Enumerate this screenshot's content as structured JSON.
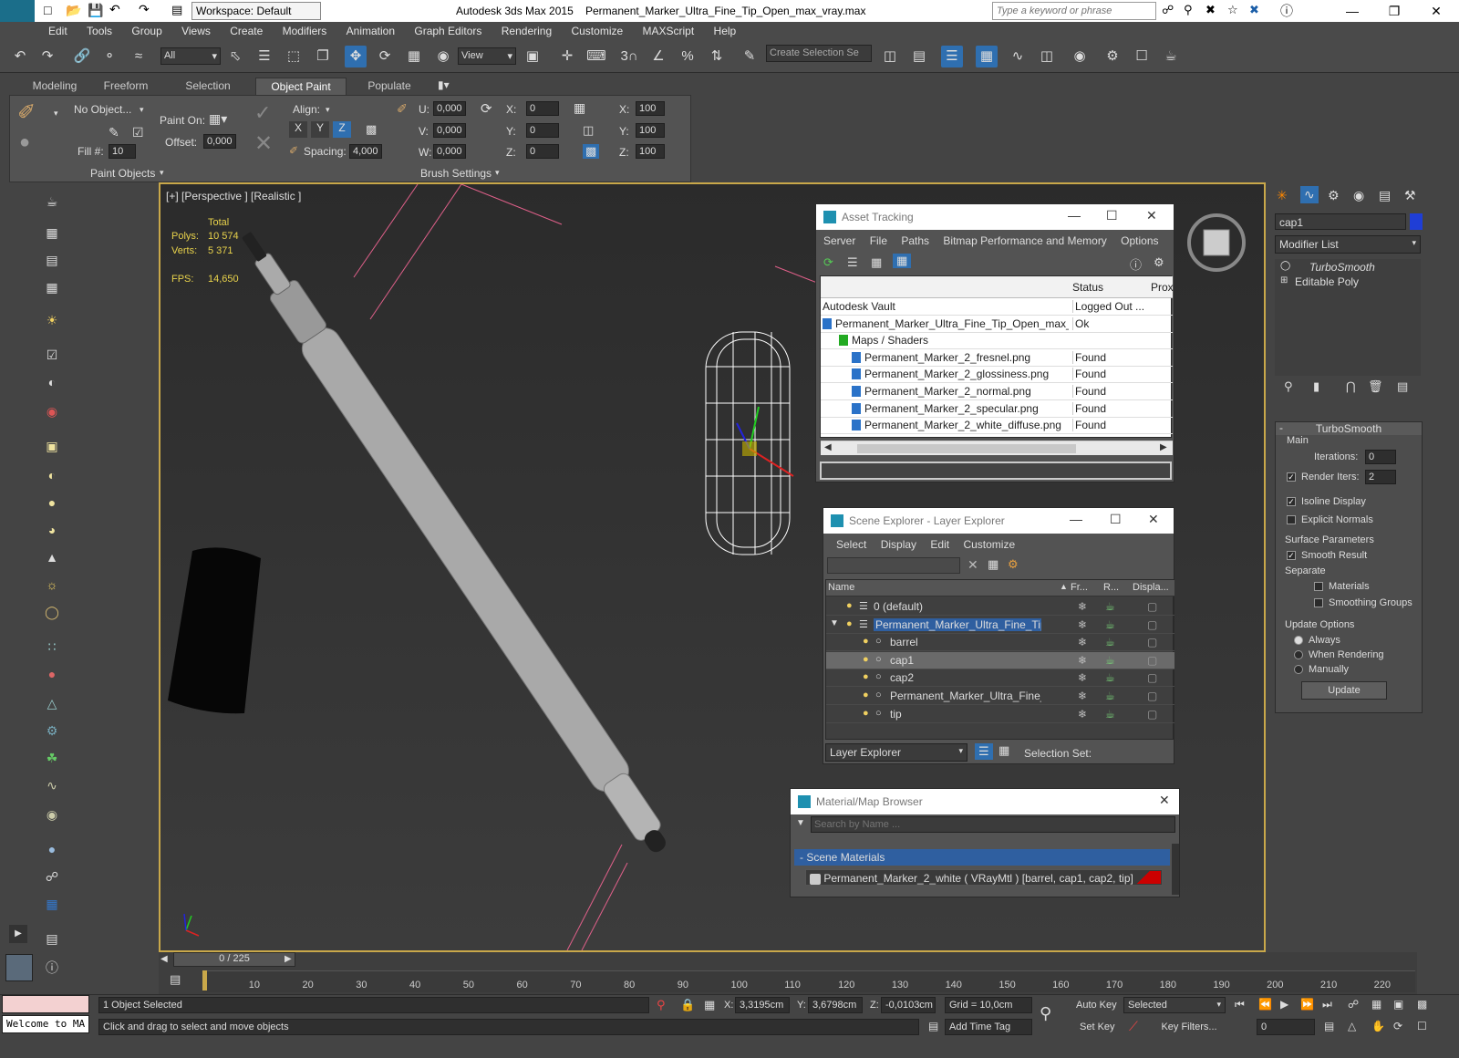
{
  "titlebar": {
    "workspace": "Workspace: Default",
    "app_title": "Autodesk 3ds Max  2015",
    "file_name": "Permanent_Marker_Ultra_Fine_Tip_Open_max_vray.max",
    "search_placeholder": "Type a keyword or phrase"
  },
  "menu": [
    "Edit",
    "Tools",
    "Group",
    "Views",
    "Create",
    "Modifiers",
    "Animation",
    "Graph Editors",
    "Rendering",
    "Customize",
    "MAXScript",
    "Help"
  ],
  "toolbar": {
    "selection_filter": "All",
    "ref_coord": "View",
    "selection_set_placeholder": "Create Selection Se"
  },
  "ribbon": {
    "tabs": [
      "Modeling",
      "Freeform",
      "Selection",
      "Object Paint",
      "Populate"
    ],
    "active_tab": "Object Paint",
    "no_object": "No Object...",
    "paint_on": "Paint On:",
    "offset_label": "Offset:",
    "offset_val": "0,000",
    "fill_label": "Fill #:",
    "fill_val": "10",
    "align_label": "Align:",
    "spacing_label": "Spacing:",
    "spacing_val": "4,000",
    "u_label": "U:",
    "u_val": "0,000",
    "v_label": "V:",
    "v_val": "0,000",
    "w_label": "W:",
    "w_val": "0,000",
    "x_label": "X:",
    "x_val": "0",
    "y_label": "Y:",
    "y_val": "0",
    "z_label": "Z:",
    "z_val": "0",
    "sx_label": "X:",
    "sx_val": "100",
    "sy_label": "Y:",
    "sy_val": "100",
    "sz_label": "Z:",
    "sz_val": "100",
    "paint_objects": "Paint Objects",
    "brush_settings": "Brush Settings"
  },
  "viewport": {
    "label": "[+] [Perspective ] [Realistic ]",
    "total": "Total",
    "polys_label": "Polys:",
    "polys": "10 574",
    "verts_label": "Verts:",
    "verts": "5 371",
    "fps_label": "FPS:",
    "fps": "14,650"
  },
  "asset_tracking": {
    "title": "Asset Tracking",
    "menu": [
      "Server",
      "File",
      "Paths",
      "Bitmap Performance and Memory",
      "Options"
    ],
    "col_status": "Status",
    "col_proxy": "Prox",
    "rows": [
      {
        "name": "Autodesk Vault",
        "status": "Logged Out ..."
      },
      {
        "name": "Permanent_Marker_Ultra_Fine_Tip_Open_max_...",
        "status": "Ok"
      },
      {
        "name": "Maps / Shaders",
        "status": ""
      },
      {
        "name": "Permanent_Marker_2_fresnel.png",
        "status": "Found"
      },
      {
        "name": "Permanent_Marker_2_glossiness.png",
        "status": "Found"
      },
      {
        "name": "Permanent_Marker_2_normal.png",
        "status": "Found"
      },
      {
        "name": "Permanent_Marker_2_specular.png",
        "status": "Found"
      },
      {
        "name": "Permanent_Marker_2_white_diffuse.png",
        "status": "Found"
      }
    ]
  },
  "scene_explorer": {
    "title": "Scene Explorer - Layer Explorer",
    "menu": [
      "Select",
      "Display",
      "Edit",
      "Customize"
    ],
    "col_name": "Name",
    "col_fr": "Fr...",
    "col_r": "R...",
    "col_disp": "Displa...",
    "rows": [
      "0 (default)",
      "Permanent_Marker_Ultra_Fine_Tip_Open",
      "barrel",
      "cap1",
      "cap2",
      "Permanent_Marker_Ultra_Fine_Tip_O...",
      "tip"
    ],
    "footer_dropdown": "Layer Explorer",
    "selection_set": "Selection Set:"
  },
  "material_browser": {
    "title": "Material/Map Browser",
    "search_placeholder": "Search by Name ...",
    "group": "- Scene Materials",
    "material": "Permanent_Marker_2_white  ( VRayMtl )  [barrel, cap1, cap2, tip]"
  },
  "command_panel": {
    "object_name": "cap1",
    "modifier_list": "Modifier List",
    "stack": [
      "TurboSmooth",
      "Editable Poly"
    ],
    "rollout_title": "TurboSmooth",
    "main": "Main",
    "iterations_label": "Iterations:",
    "iterations": "0",
    "render_iters_label": "Render Iters:",
    "render_iters": "2",
    "isoline": "Isoline Display",
    "explicit_normals": "Explicit Normals",
    "surface_params": "Surface Parameters",
    "smooth_result": "Smooth Result",
    "separate": "Separate",
    "materials": "Materials",
    "smoothing_groups": "Smoothing Groups",
    "update_options": "Update Options",
    "always": "Always",
    "when_rendering": "When Rendering",
    "manually": "Manually",
    "update_btn": "Update"
  },
  "timeline": {
    "frame": "0 / 225",
    "ticks": [
      "10",
      "20",
      "30",
      "40",
      "50",
      "60",
      "70",
      "80",
      "90",
      "100",
      "110",
      "120",
      "130",
      "140",
      "150",
      "160",
      "170",
      "180",
      "190",
      "200",
      "210",
      "220"
    ]
  },
  "status": {
    "welcome": "Welcome to MA",
    "selected": "1 Object Selected",
    "prompt": "Click and drag to select and move objects",
    "x_label": "X:",
    "x": "3,3195cm",
    "y_label": "Y:",
    "y": "3,6798cm",
    "z_label": "Z:",
    "z": "-0,0103cm",
    "grid": "Grid = 10,0cm",
    "add_time_tag": "Add Time Tag",
    "auto_key": "Auto Key",
    "set_key": "Set Key",
    "selected_dd": "Selected",
    "key_filters": "Key Filters...",
    "frame_field": "0"
  }
}
